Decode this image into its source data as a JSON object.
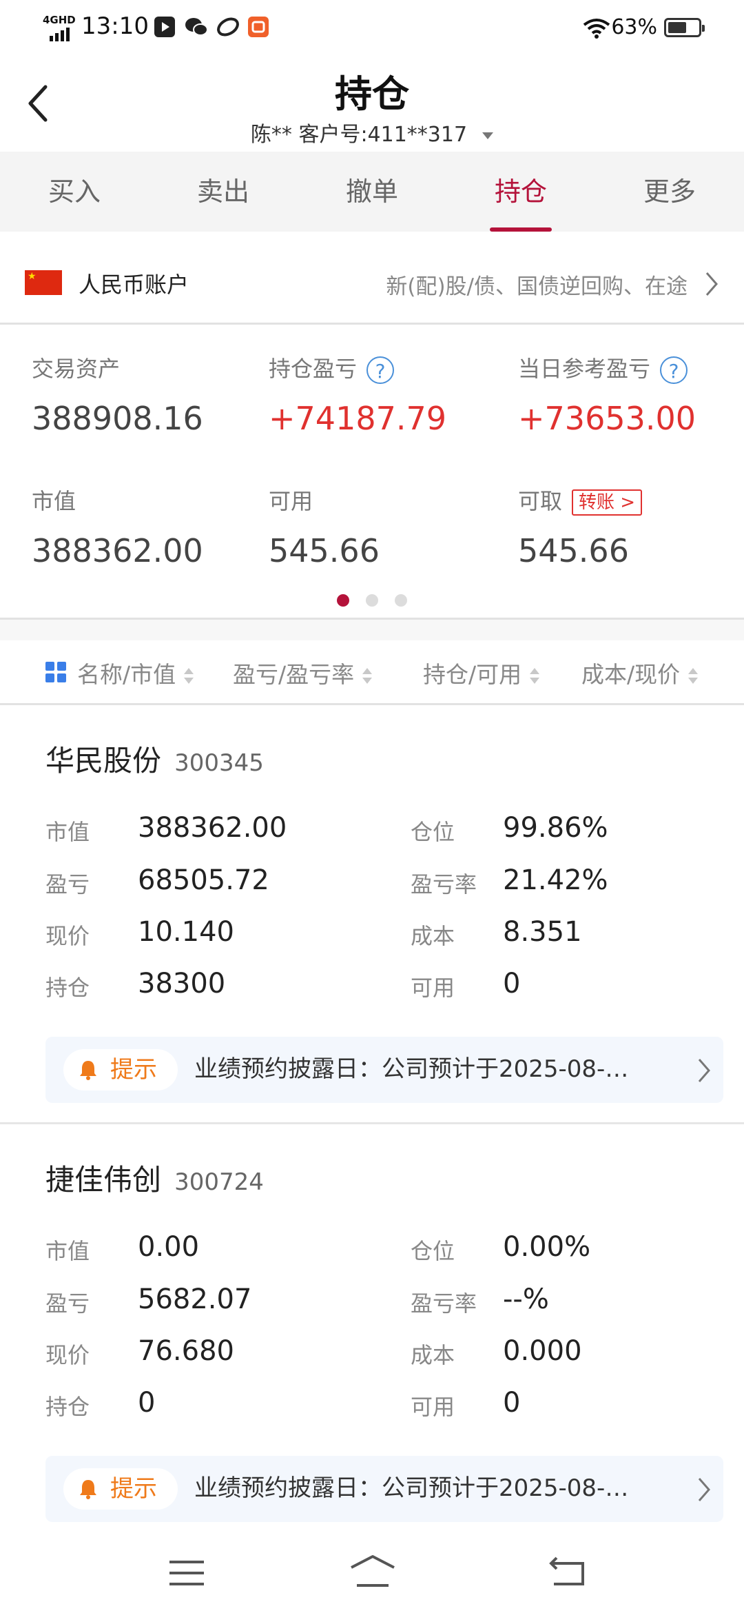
{
  "status_bar": {
    "time": "13:10",
    "network": "4GHD",
    "battery_pct": "63%",
    "app_icons": [
      "video-app-icon",
      "wechat-icon",
      "link-app-icon",
      "shopping-app-icon"
    ]
  },
  "header": {
    "title": "持仓",
    "account_line": "陈**  客户号:411**317"
  },
  "tabs": [
    {
      "label": "买入",
      "active": false
    },
    {
      "label": "卖出",
      "active": false
    },
    {
      "label": "撤单",
      "active": false
    },
    {
      "label": "持仓",
      "active": true
    },
    {
      "label": "更多",
      "active": false
    }
  ],
  "account": {
    "currency_label": "人民币账户",
    "description": "新(配)股/债、国债逆回购、在途"
  },
  "assets": {
    "trade_assets_label": "交易资产",
    "trade_assets": "388908.16",
    "position_pl_label": "持仓盈亏",
    "position_pl": "+74187.79",
    "daily_pl_label": "当日参考盈亏",
    "daily_pl": "+73653.00",
    "market_value_label": "市值",
    "market_value": "388362.00",
    "available_label": "可用",
    "available": "545.66",
    "withdrawable_label": "可取",
    "withdrawable": "545.66",
    "transfer_label": "转账 >",
    "help_glyph": "?"
  },
  "pager": {
    "count": 3,
    "active": 0
  },
  "columns": [
    "名称/市值",
    "盈亏/盈亏率",
    "持仓/可用",
    "成本/现价"
  ],
  "holdings": [
    {
      "name": "华民股份",
      "code": "300345",
      "market_value_label": "市值",
      "market_value": "388362.00",
      "position_label": "仓位",
      "position": "99.86%",
      "pl_label": "盈亏",
      "pl": "68505.72",
      "pl_rate_label": "盈亏率",
      "pl_rate": "21.42%",
      "price_label": "现价",
      "price": "10.140",
      "cost_label": "成本",
      "cost": "8.351",
      "holding_label": "持仓",
      "holding": "38300",
      "avail_label": "可用",
      "avail": "0",
      "tip_badge": "提示",
      "tip_text": "业绩预约披露日：公司预计于2025-08-…"
    },
    {
      "name": "捷佳伟创",
      "code": "300724",
      "market_value_label": "市值",
      "market_value": "0.00",
      "position_label": "仓位",
      "position": "0.00%",
      "pl_label": "盈亏",
      "pl": "5682.07",
      "pl_rate_label": "盈亏率",
      "pl_rate": "--%",
      "price_label": "现价",
      "price": "76.680",
      "cost_label": "成本",
      "cost": "0.000",
      "holding_label": "持仓",
      "holding": "0",
      "avail_label": "可用",
      "avail": "0",
      "tip_badge": "提示",
      "tip_text": "业绩预约披露日：公司预计于2025-08-…"
    }
  ],
  "colors": {
    "accent": "#b4123a",
    "gain": "#e0312f",
    "tip": "#ef7a1a",
    "link": "#4a90d9"
  }
}
